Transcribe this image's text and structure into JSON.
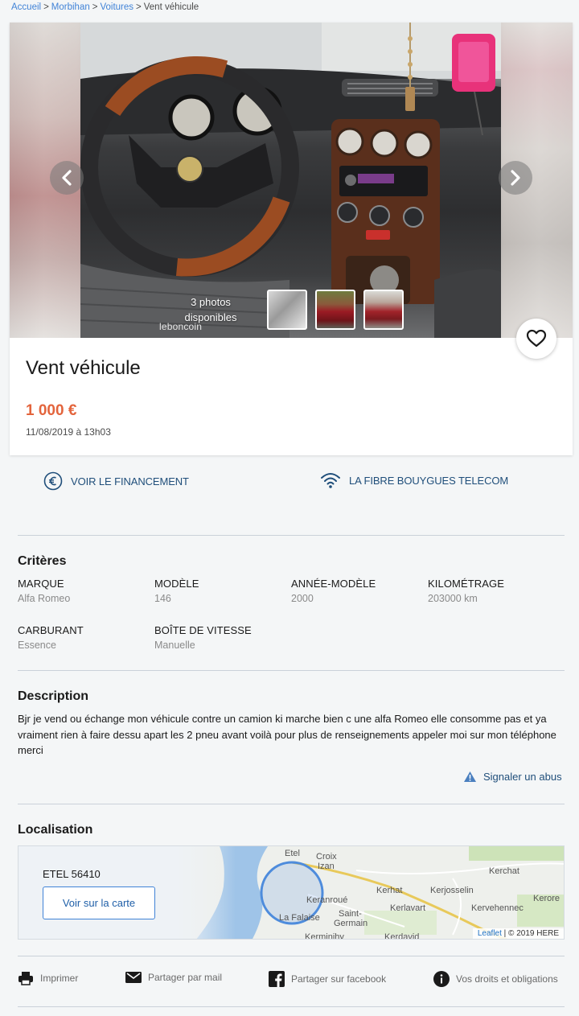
{
  "breadcrumb": {
    "items": [
      "Accueil",
      "Morbihan",
      "Voitures"
    ],
    "current": "Vent véhicule",
    "separator": ">"
  },
  "gallery": {
    "photo_count_line1": "3 photos",
    "photo_count_line2": "disponibles",
    "watermark": "leboncoin",
    "thumbnail_count": 3
  },
  "ad": {
    "title": "Vent véhicule",
    "price": "1 000 €",
    "date": "11/08/2019 à 13h03"
  },
  "services": {
    "financing": "VOIR LE FINANCEMENT",
    "fiber": "LA FIBRE BOUYGUES TELECOM"
  },
  "criteria": {
    "title": "Critères",
    "items": [
      {
        "key": "MARQUE",
        "value": "Alfa Romeo"
      },
      {
        "key": "MODÈLE",
        "value": "146"
      },
      {
        "key": "ANNÉE-MODÈLE",
        "value": "2000"
      },
      {
        "key": "KILOMÉTRAGE",
        "value": "203000 km"
      },
      {
        "key": "CARBURANT",
        "value": "Essence"
      },
      {
        "key": "BOÎTE DE VITESSE",
        "value": "Manuelle"
      }
    ]
  },
  "description": {
    "title": "Description",
    "text": "Bjr je vend ou échange mon véhicule contre un camion ki marche bien c une alfa Romeo elle consomme pas et ya vraiment rien à faire dessu apart les 2 pneu avant voilà pour plus de renseignements appeler moi sur mon téléphone merci",
    "report_label": "Signaler un abus"
  },
  "location": {
    "title": "Localisation",
    "city": "ETEL 56410",
    "map_button": "Voir sur la carte",
    "map_labels": [
      "Etel",
      "Croix",
      "Izan",
      "Kerchat",
      "Kerhat",
      "Kerjosselin",
      "Kerore",
      "Kervehennec",
      "Kerlavart",
      "Saint-",
      "Germain",
      "La Falaise",
      "Keranroué",
      "Kerminihy",
      "Kerdavid"
    ],
    "attribution_leaflet": "Leaflet",
    "attribution_rest": " | © 2019 HERE"
  },
  "footer": {
    "print": "Imprimer",
    "share_mail": "Partager par mail",
    "share_facebook": "Partager sur facebook",
    "rights": "Vos droits et obligations"
  },
  "colors": {
    "price": "#e3643c",
    "link": "#4183d7",
    "service_text": "#1f4e7a"
  }
}
